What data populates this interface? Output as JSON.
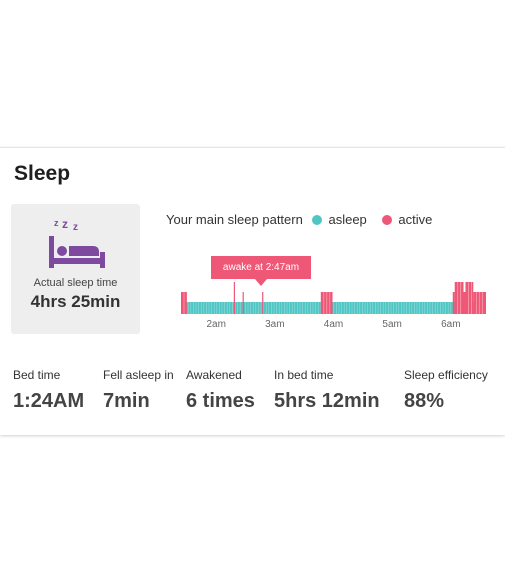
{
  "card": {
    "title": "Sleep",
    "summary": {
      "icon": "sleeping-in-bed-icon",
      "zzz": [
        "z",
        "z",
        "z"
      ],
      "label": "Actual sleep time",
      "value": "4hrs 25min"
    },
    "legend": {
      "title": "Your main sleep pattern",
      "items": [
        {
          "label": "asleep",
          "color": "#4fc6c4"
        },
        {
          "label": "active",
          "color": "#ef5777"
        }
      ]
    },
    "tooltip": "awake at 2:47am",
    "stats": [
      {
        "label": "Bed time",
        "value": "1:24AM"
      },
      {
        "label": "Fell asleep in",
        "value": "7min"
      },
      {
        "label": "Awakened",
        "value": "6 times"
      },
      {
        "label": "In bed time",
        "value": "5hrs 12min"
      },
      {
        "label": "Sleep efficiency",
        "value": "88%"
      }
    ]
  },
  "chart_data": {
    "type": "bar",
    "x_ticks": [
      "2am",
      "3am",
      "4am",
      "5am",
      "6am"
    ],
    "x_range": [
      "1:24",
      "6:36"
    ],
    "series": [
      {
        "name": "asleep",
        "color": "#4fc6c4"
      },
      {
        "name": "active",
        "color": "#ef5777"
      }
    ],
    "active_periods": [
      {
        "start": "1:24",
        "end": "1:30",
        "level": 2
      },
      {
        "start": "2:18",
        "end": "2:19",
        "level": 3
      },
      {
        "start": "2:27",
        "end": "2:28",
        "level": 2
      },
      {
        "start": "2:47",
        "end": "2:48",
        "level": 2
      },
      {
        "start": "3:47",
        "end": "3:59",
        "level": 2
      },
      {
        "start": "6:02",
        "end": "6:04",
        "level": 2
      },
      {
        "start": "6:04",
        "end": "6:13",
        "level": 3
      },
      {
        "start": "6:13",
        "end": "6:15",
        "level": 2
      },
      {
        "start": "6:15",
        "end": "6:23",
        "level": 3
      },
      {
        "start": "6:23",
        "end": "6:36",
        "level": 2
      }
    ]
  }
}
